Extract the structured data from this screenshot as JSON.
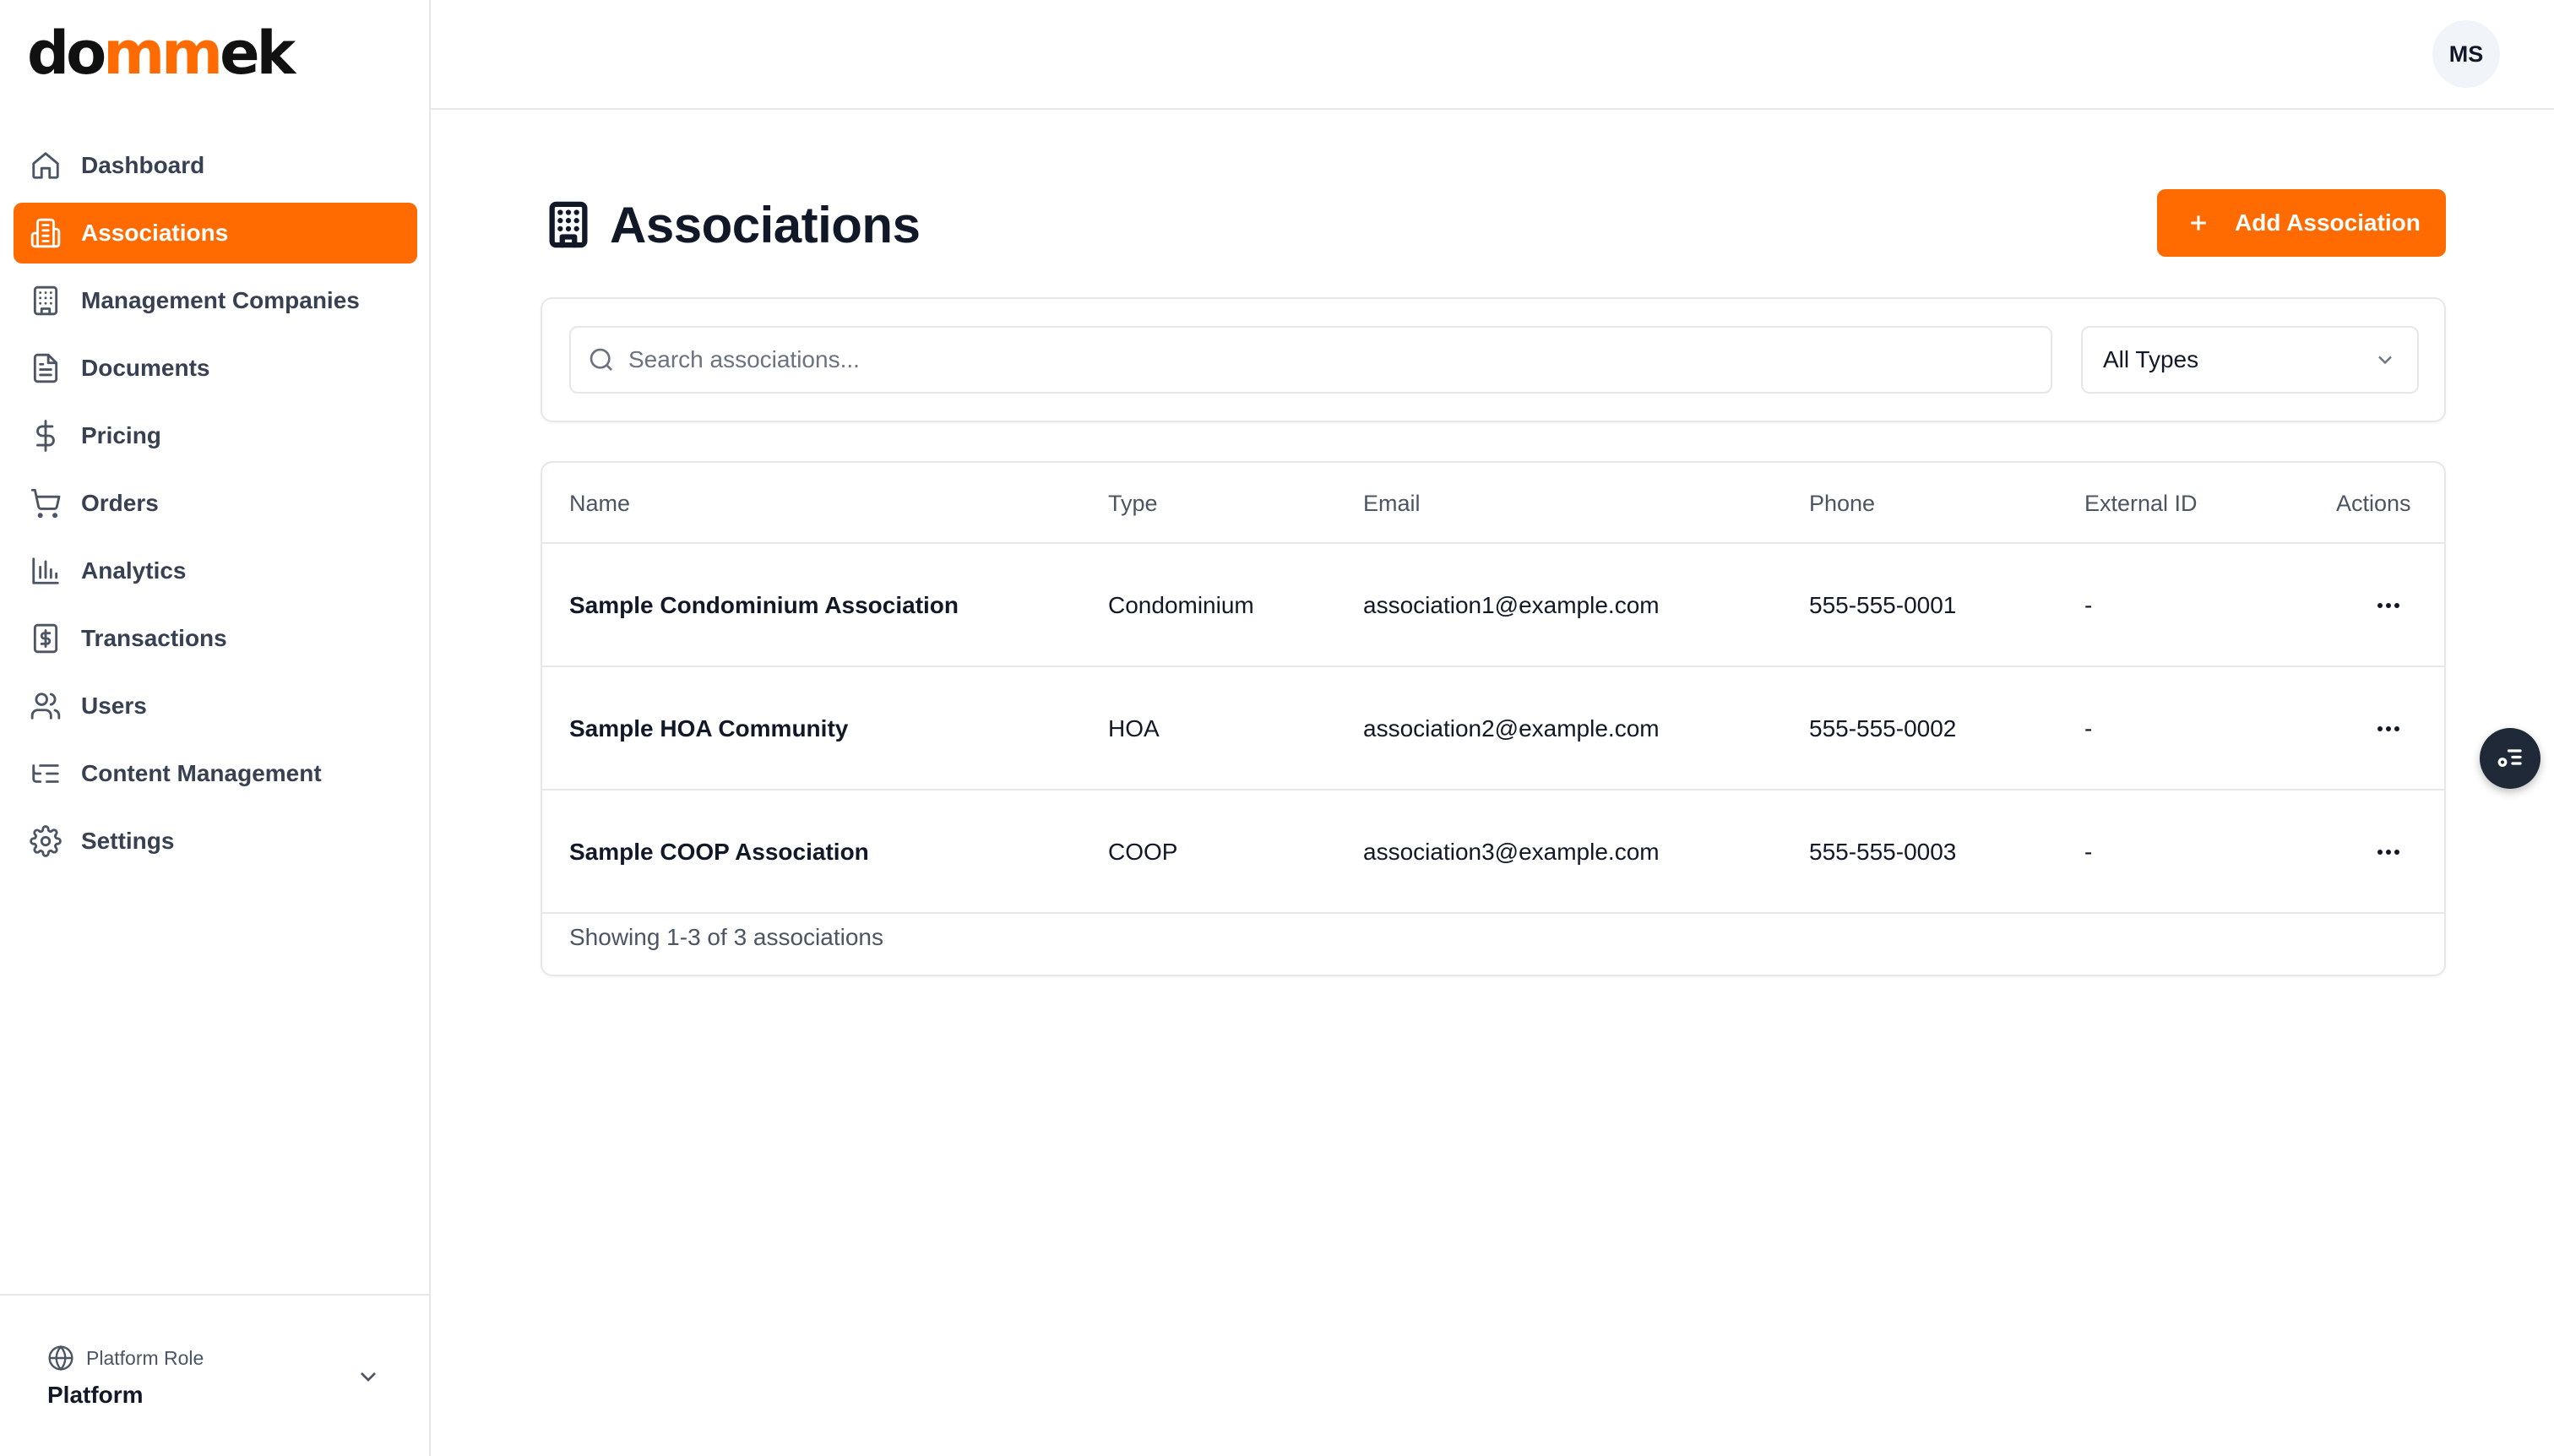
{
  "brand": {
    "logo_part1": "do",
    "logo_part2": "mm",
    "logo_part3": "ek",
    "accent_color": "#ff6b00"
  },
  "sidebar": {
    "items": [
      {
        "label": "Dashboard",
        "icon": "home-icon",
        "active": false
      },
      {
        "label": "Associations",
        "icon": "building-icon",
        "active": true
      },
      {
        "label": "Management Companies",
        "icon": "office-building-icon",
        "active": false
      },
      {
        "label": "Documents",
        "icon": "document-icon",
        "active": false
      },
      {
        "label": "Pricing",
        "icon": "dollar-icon",
        "active": false
      },
      {
        "label": "Orders",
        "icon": "cart-icon",
        "active": false
      },
      {
        "label": "Analytics",
        "icon": "bar-chart-icon",
        "active": false
      },
      {
        "label": "Transactions",
        "icon": "receipt-icon",
        "active": false
      },
      {
        "label": "Users",
        "icon": "users-icon",
        "active": false
      },
      {
        "label": "Content Management",
        "icon": "list-tree-icon",
        "active": false
      },
      {
        "label": "Settings",
        "icon": "gear-icon",
        "active": false
      }
    ],
    "footer": {
      "caption": "Platform Role",
      "value": "Platform"
    }
  },
  "topbar": {
    "avatar_initials": "MS"
  },
  "page": {
    "title": "Associations",
    "add_button_label": "Add Association"
  },
  "filters": {
    "search_placeholder": "Search associations...",
    "search_value": "",
    "type_selected": "All Types"
  },
  "table": {
    "columns": [
      "Name",
      "Type",
      "Email",
      "Phone",
      "External ID",
      "Actions"
    ],
    "rows": [
      {
        "name": "Sample Condominium Association",
        "type": "Condominium",
        "email": "association1@example.com",
        "phone": "555-555-0001",
        "external_id": "-"
      },
      {
        "name": "Sample HOA Community",
        "type": "HOA",
        "email": "association2@example.com",
        "phone": "555-555-0002",
        "external_id": "-"
      },
      {
        "name": "Sample COOP Association",
        "type": "COOP",
        "email": "association3@example.com",
        "phone": "555-555-0003",
        "external_id": "-"
      }
    ],
    "footer_text": "Showing 1-3 of 3 associations"
  }
}
